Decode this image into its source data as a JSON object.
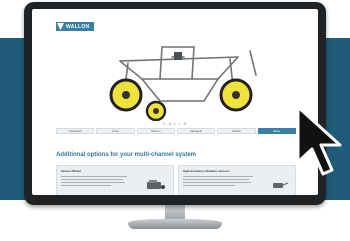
{
  "logo": {
    "brand": "WALLON"
  },
  "product": {
    "caption": "C A L I S"
  },
  "tabs": [
    {
      "label": "Fahrgestell"
    },
    {
      "label": "Achse"
    },
    {
      "label": "Rahmen"
    },
    {
      "label": "Messgerät"
    },
    {
      "label": "Zubehör"
    },
    {
      "label": "Weiter"
    }
  ],
  "section": {
    "heading": "Additional options for your multi-channel system"
  },
  "cards": [
    {
      "title": "Sensor-Modul"
    },
    {
      "title": "High-accuracy vibration sensors"
    }
  ],
  "colors": {
    "band": "#1f5b78",
    "accent": "#3a7fa5",
    "heading": "#2f79a6",
    "wheel": "#f0e23a"
  },
  "icons": [
    "logo-mark-icon",
    "mouse-cursor-icon"
  ]
}
